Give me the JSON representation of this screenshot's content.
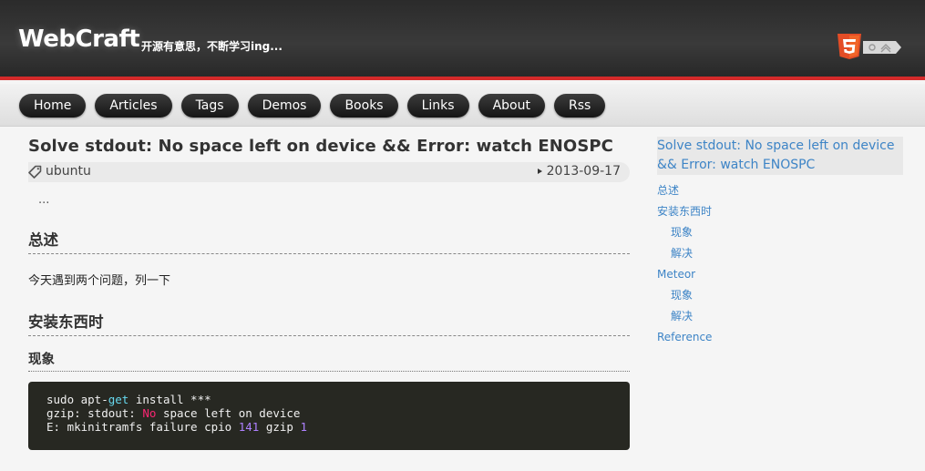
{
  "header": {
    "logo": "WebCraft",
    "tagline": "开源有意思，不断学习ing...",
    "brand_color": "#d42a2a"
  },
  "nav": {
    "items": [
      {
        "label": "Home"
      },
      {
        "label": "Articles"
      },
      {
        "label": "Tags"
      },
      {
        "label": "Demos"
      },
      {
        "label": "Books"
      },
      {
        "label": "Links"
      },
      {
        "label": "About"
      },
      {
        "label": "Rss"
      }
    ]
  },
  "article": {
    "title": "Solve stdout: No space left on device && Error: watch ENOSPC",
    "tag": "ubuntu",
    "tag_icon": "tag-icon",
    "date": "2013-09-17",
    "ellipsis": "...",
    "sections": {
      "overview_heading": "总述",
      "overview_text": "今天遇到两个问题，列一下",
      "install_heading": "安装东西时",
      "symptom_heading": "现象"
    }
  },
  "toc": {
    "title": "Solve stdout: No space left on device && Error: watch ENOSPC",
    "items": [
      {
        "label": "总述"
      },
      {
        "label": "安装东西时"
      },
      {
        "label": "现象"
      },
      {
        "label": "解决"
      },
      {
        "label": "Meteor"
      },
      {
        "label": "现象"
      },
      {
        "label": "解决"
      },
      {
        "label": "Reference"
      }
    ],
    "link_color": "#3d84c6"
  }
}
